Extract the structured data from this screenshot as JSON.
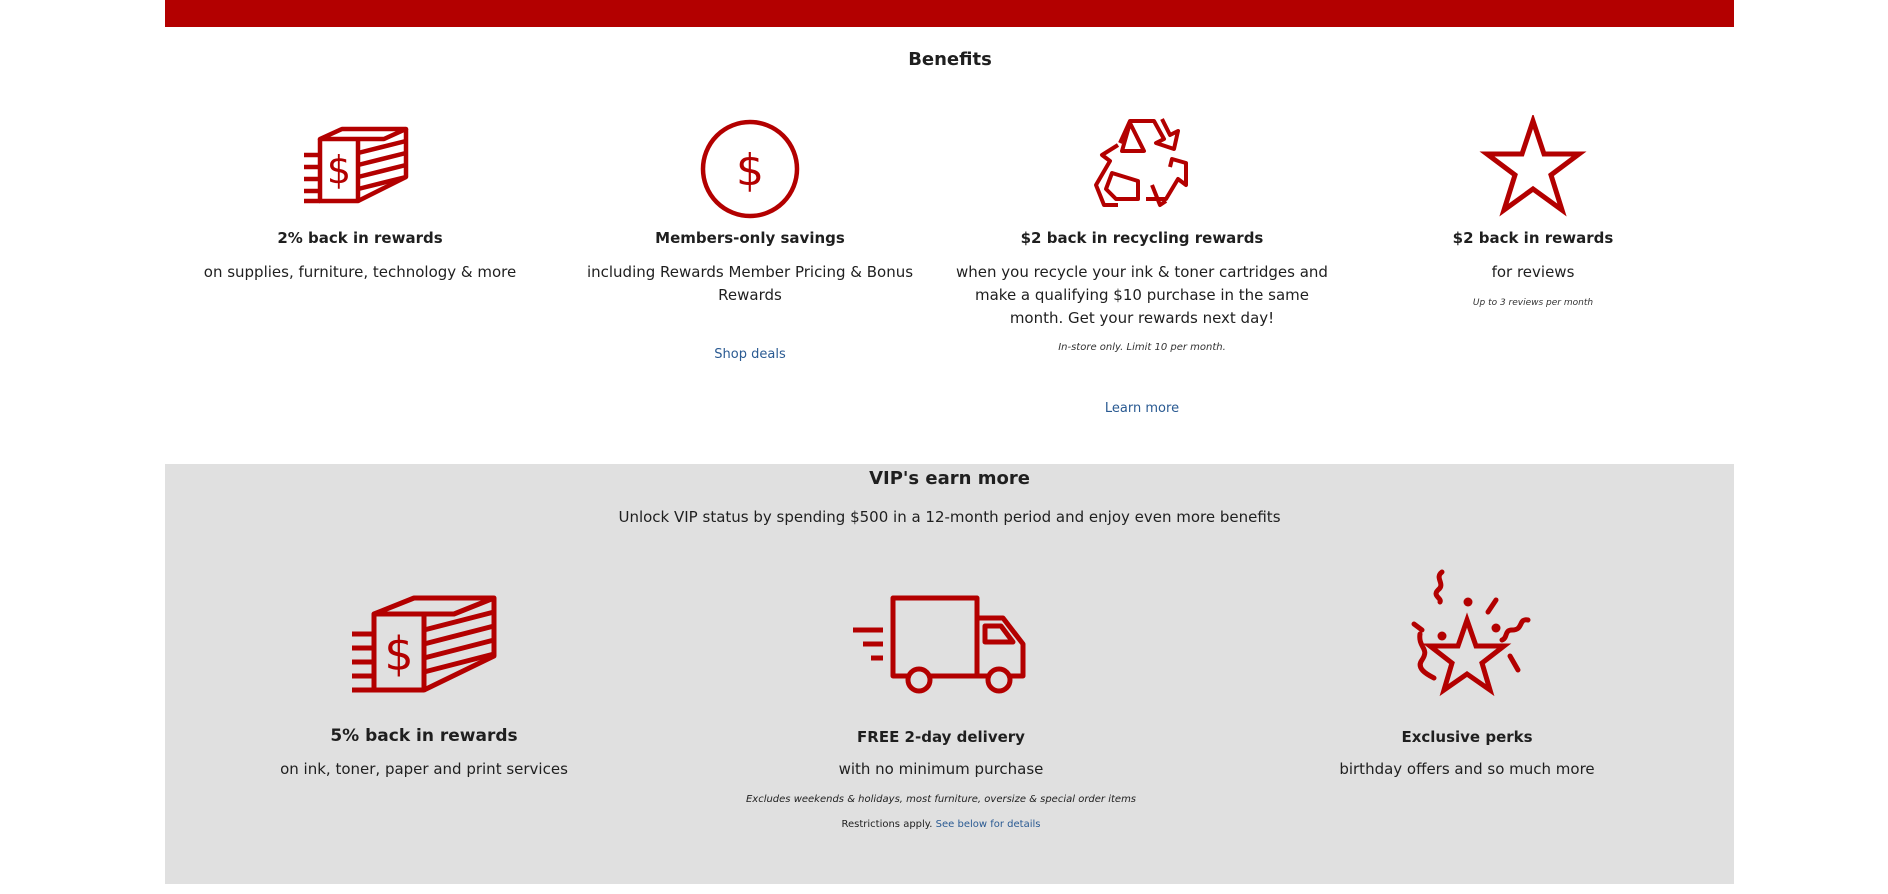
{
  "benefits": {
    "title": "Benefits",
    "items": [
      {
        "icon": "cash-stack-icon",
        "title": "2% back in rewards",
        "desc": "on supplies, furniture, technology & more"
      },
      {
        "icon": "dollar-circle-icon",
        "title": "Members-only savings",
        "desc": "including Rewards Member Pricing & Bonus Rewards",
        "link": "Shop deals"
      },
      {
        "icon": "recycle-icon",
        "title": "$2 back in recycling rewards",
        "desc": "when you recycle your ink & toner cartridges and make a qualifying $10 purchase in the same month. Get your rewards next day!",
        "note": "In-store only. Limit 10 per month.",
        "link": "Learn more"
      },
      {
        "icon": "star-icon",
        "title": "$2 back in rewards",
        "desc": "for reviews",
        "note": "Up to 3 reviews per month"
      }
    ]
  },
  "vip": {
    "title": "VIP's earn more",
    "subtitle": "Unlock VIP status by spending $500 in a 12-month period and enjoy even more benefits",
    "items": [
      {
        "icon": "cash-stack-icon",
        "title": "5% back in rewards",
        "desc": "on ink, toner, paper and print services"
      },
      {
        "icon": "delivery-truck-icon",
        "title": "FREE 2-day delivery",
        "desc": "with no minimum purchase",
        "note": "Excludes weekends & holidays, most furniture, oversize & special order items",
        "restrict_prefix": "Restrictions apply.",
        "restrict_link": "See below for details"
      },
      {
        "icon": "celebration-star-icon",
        "title": "Exclusive perks",
        "desc": "birthday offers and so much more"
      }
    ]
  },
  "colors": {
    "brand_red": "#b30000",
    "link_blue": "#2a5a92",
    "vip_bg": "#e0e0e0"
  }
}
